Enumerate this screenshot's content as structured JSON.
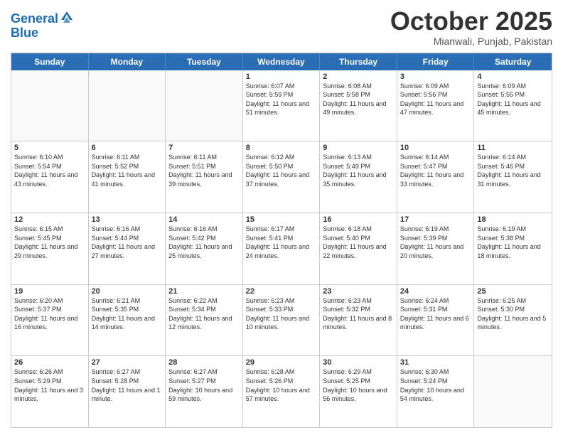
{
  "header": {
    "logo_line1": "General",
    "logo_line2": "Blue",
    "month": "October 2025",
    "location": "Mianwali, Punjab, Pakistan"
  },
  "days_of_week": [
    "Sunday",
    "Monday",
    "Tuesday",
    "Wednesday",
    "Thursday",
    "Friday",
    "Saturday"
  ],
  "weeks": [
    [
      {
        "day": "",
        "sunrise": "",
        "sunset": "",
        "daylight": ""
      },
      {
        "day": "",
        "sunrise": "",
        "sunset": "",
        "daylight": ""
      },
      {
        "day": "",
        "sunrise": "",
        "sunset": "",
        "daylight": ""
      },
      {
        "day": "1",
        "sunrise": "Sunrise: 6:07 AM",
        "sunset": "Sunset: 5:59 PM",
        "daylight": "Daylight: 11 hours and 51 minutes."
      },
      {
        "day": "2",
        "sunrise": "Sunrise: 6:08 AM",
        "sunset": "Sunset: 5:58 PM",
        "daylight": "Daylight: 11 hours and 49 minutes."
      },
      {
        "day": "3",
        "sunrise": "Sunrise: 6:09 AM",
        "sunset": "Sunset: 5:56 PM",
        "daylight": "Daylight: 11 hours and 47 minutes."
      },
      {
        "day": "4",
        "sunrise": "Sunrise: 6:09 AM",
        "sunset": "Sunset: 5:55 PM",
        "daylight": "Daylight: 11 hours and 45 minutes."
      }
    ],
    [
      {
        "day": "5",
        "sunrise": "Sunrise: 6:10 AM",
        "sunset": "Sunset: 5:54 PM",
        "daylight": "Daylight: 11 hours and 43 minutes."
      },
      {
        "day": "6",
        "sunrise": "Sunrise: 6:11 AM",
        "sunset": "Sunset: 5:52 PM",
        "daylight": "Daylight: 11 hours and 41 minutes."
      },
      {
        "day": "7",
        "sunrise": "Sunrise: 6:11 AM",
        "sunset": "Sunset: 5:51 PM",
        "daylight": "Daylight: 11 hours and 39 minutes."
      },
      {
        "day": "8",
        "sunrise": "Sunrise: 6:12 AM",
        "sunset": "Sunset: 5:50 PM",
        "daylight": "Daylight: 11 hours and 37 minutes."
      },
      {
        "day": "9",
        "sunrise": "Sunrise: 6:13 AM",
        "sunset": "Sunset: 5:49 PM",
        "daylight": "Daylight: 11 hours and 35 minutes."
      },
      {
        "day": "10",
        "sunrise": "Sunrise: 6:14 AM",
        "sunset": "Sunset: 5:47 PM",
        "daylight": "Daylight: 11 hours and 33 minutes."
      },
      {
        "day": "11",
        "sunrise": "Sunrise: 6:14 AM",
        "sunset": "Sunset: 5:46 PM",
        "daylight": "Daylight: 11 hours and 31 minutes."
      }
    ],
    [
      {
        "day": "12",
        "sunrise": "Sunrise: 6:15 AM",
        "sunset": "Sunset: 5:45 PM",
        "daylight": "Daylight: 11 hours and 29 minutes."
      },
      {
        "day": "13",
        "sunrise": "Sunrise: 6:16 AM",
        "sunset": "Sunset: 5:44 PM",
        "daylight": "Daylight: 11 hours and 27 minutes."
      },
      {
        "day": "14",
        "sunrise": "Sunrise: 6:16 AM",
        "sunset": "Sunset: 5:42 PM",
        "daylight": "Daylight: 11 hours and 25 minutes."
      },
      {
        "day": "15",
        "sunrise": "Sunrise: 6:17 AM",
        "sunset": "Sunset: 5:41 PM",
        "daylight": "Daylight: 11 hours and 24 minutes."
      },
      {
        "day": "16",
        "sunrise": "Sunrise: 6:18 AM",
        "sunset": "Sunset: 5:40 PM",
        "daylight": "Daylight: 11 hours and 22 minutes."
      },
      {
        "day": "17",
        "sunrise": "Sunrise: 6:19 AM",
        "sunset": "Sunset: 5:39 PM",
        "daylight": "Daylight: 11 hours and 20 minutes."
      },
      {
        "day": "18",
        "sunrise": "Sunrise: 6:19 AM",
        "sunset": "Sunset: 5:38 PM",
        "daylight": "Daylight: 11 hours and 18 minutes."
      }
    ],
    [
      {
        "day": "19",
        "sunrise": "Sunrise: 6:20 AM",
        "sunset": "Sunset: 5:37 PM",
        "daylight": "Daylight: 11 hours and 16 minutes."
      },
      {
        "day": "20",
        "sunrise": "Sunrise: 6:21 AM",
        "sunset": "Sunset: 5:35 PM",
        "daylight": "Daylight: 11 hours and 14 minutes."
      },
      {
        "day": "21",
        "sunrise": "Sunrise: 6:22 AM",
        "sunset": "Sunset: 5:34 PM",
        "daylight": "Daylight: 11 hours and 12 minutes."
      },
      {
        "day": "22",
        "sunrise": "Sunrise: 6:23 AM",
        "sunset": "Sunset: 5:33 PM",
        "daylight": "Daylight: 11 hours and 10 minutes."
      },
      {
        "day": "23",
        "sunrise": "Sunrise: 6:23 AM",
        "sunset": "Sunset: 5:32 PM",
        "daylight": "Daylight: 11 hours and 8 minutes."
      },
      {
        "day": "24",
        "sunrise": "Sunrise: 6:24 AM",
        "sunset": "Sunset: 5:31 PM",
        "daylight": "Daylight: 11 hours and 6 minutes."
      },
      {
        "day": "25",
        "sunrise": "Sunrise: 6:25 AM",
        "sunset": "Sunset: 5:30 PM",
        "daylight": "Daylight: 11 hours and 5 minutes."
      }
    ],
    [
      {
        "day": "26",
        "sunrise": "Sunrise: 6:26 AM",
        "sunset": "Sunset: 5:29 PM",
        "daylight": "Daylight: 11 hours and 3 minutes."
      },
      {
        "day": "27",
        "sunrise": "Sunrise: 6:27 AM",
        "sunset": "Sunset: 5:28 PM",
        "daylight": "Daylight: 11 hours and 1 minute."
      },
      {
        "day": "28",
        "sunrise": "Sunrise: 6:27 AM",
        "sunset": "Sunset: 5:27 PM",
        "daylight": "Daylight: 10 hours and 59 minutes."
      },
      {
        "day": "29",
        "sunrise": "Sunrise: 6:28 AM",
        "sunset": "Sunset: 5:26 PM",
        "daylight": "Daylight: 10 hours and 57 minutes."
      },
      {
        "day": "30",
        "sunrise": "Sunrise: 6:29 AM",
        "sunset": "Sunset: 5:25 PM",
        "daylight": "Daylight: 10 hours and 56 minutes."
      },
      {
        "day": "31",
        "sunrise": "Sunrise: 6:30 AM",
        "sunset": "Sunset: 5:24 PM",
        "daylight": "Daylight: 10 hours and 54 minutes."
      },
      {
        "day": "",
        "sunrise": "",
        "sunset": "",
        "daylight": ""
      }
    ]
  ]
}
